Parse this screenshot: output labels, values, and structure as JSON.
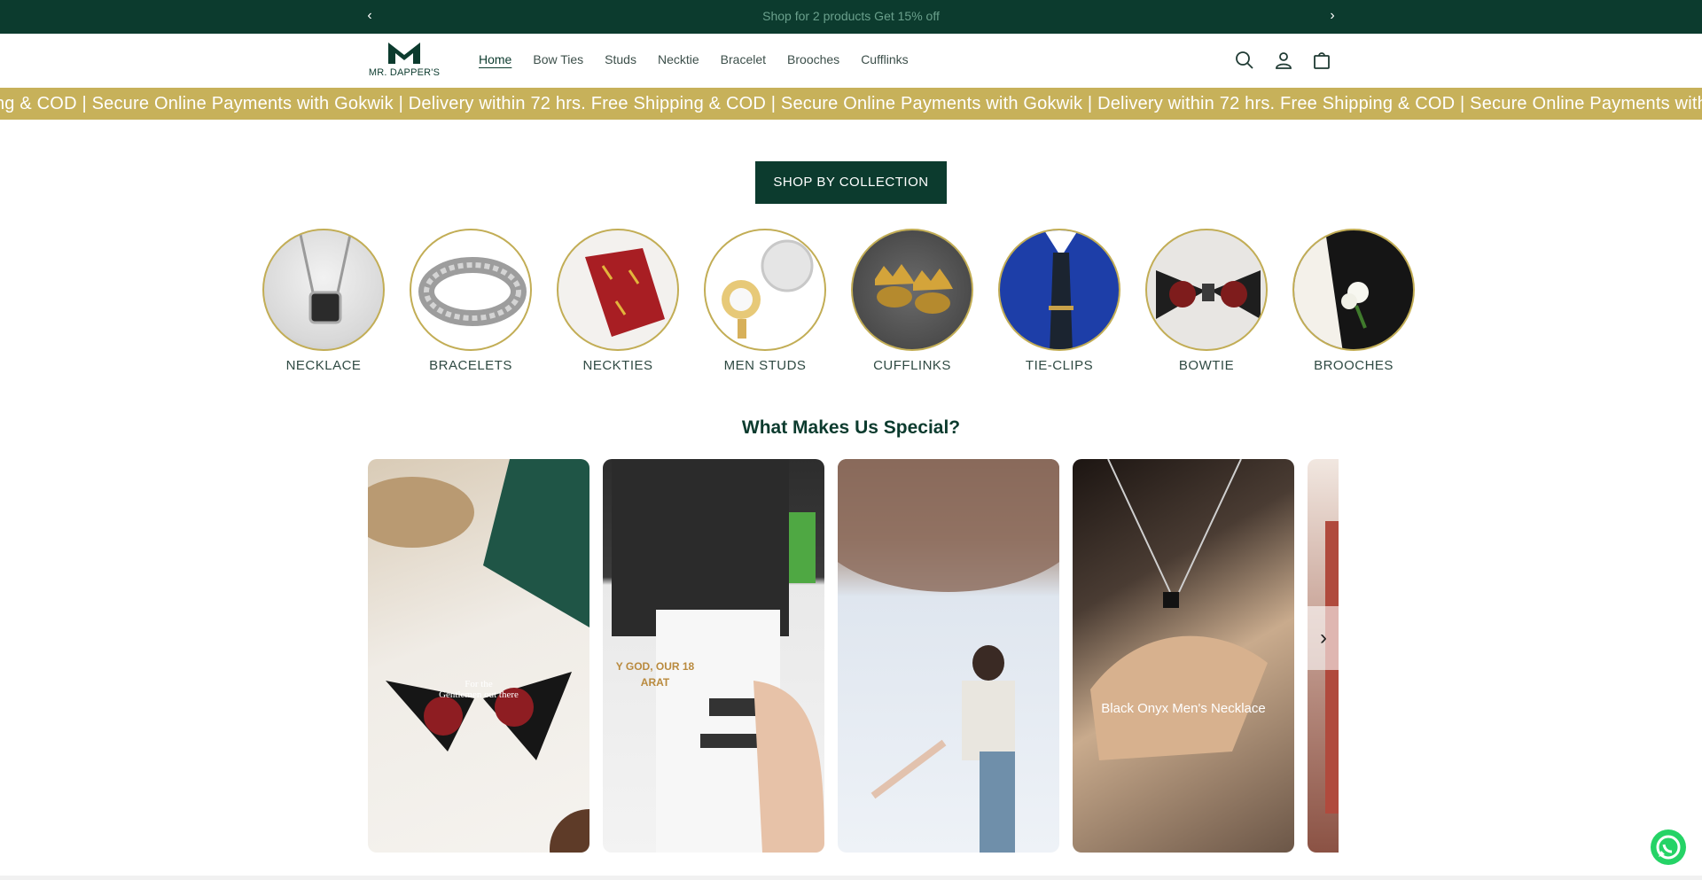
{
  "announcement": {
    "message": "Shop for 2 products Get 15% off",
    "prev_icon": "chevron-left-icon",
    "next_icon": "chevron-right-icon"
  },
  "header": {
    "logo_text": "MR. DAPPER'S",
    "nav": [
      {
        "label": "Home",
        "active": true
      },
      {
        "label": "Bow Ties"
      },
      {
        "label": "Studs"
      },
      {
        "label": "Necktie"
      },
      {
        "label": "Bracelet"
      },
      {
        "label": "Brooches"
      },
      {
        "label": "Cufflinks"
      }
    ],
    "icons": [
      "search-icon",
      "account-icon",
      "cart-icon"
    ]
  },
  "marquee": {
    "text": "ping & COD | Secure Online Payments with Gokwik | Delivery within 72 hrs.  Free Shipping & COD | Secure Online Payments with Gokwik | Delivery within 72 hrs.  Free Shipping & COD | Secure Online Payments with Gokwik"
  },
  "collection_button": "SHOP BY COLLECTION",
  "collections": [
    {
      "label": "NECKLACE"
    },
    {
      "label": "BRACELETS"
    },
    {
      "label": "NECKTIES"
    },
    {
      "label": "MEN STUDS"
    },
    {
      "label": "CUFFLINKS"
    },
    {
      "label": "TIE-CLIPS"
    },
    {
      "label": "BOWTIE"
    },
    {
      "label": "BROOCHES"
    }
  ],
  "special": {
    "title": "What Makes Us Special?",
    "cards": [
      {
        "caption": "For the\nGentlemen out there"
      },
      {
        "caption": "Y GOD, OUR 18\nARAT"
      },
      {
        "caption": ""
      },
      {
        "caption": "Black Onyx Men's Necklace"
      },
      {
        "caption": ""
      }
    ]
  },
  "colors": {
    "dark_green": "#0c3b2e",
    "gold": "#c7b15a",
    "white": "#ffffff"
  }
}
